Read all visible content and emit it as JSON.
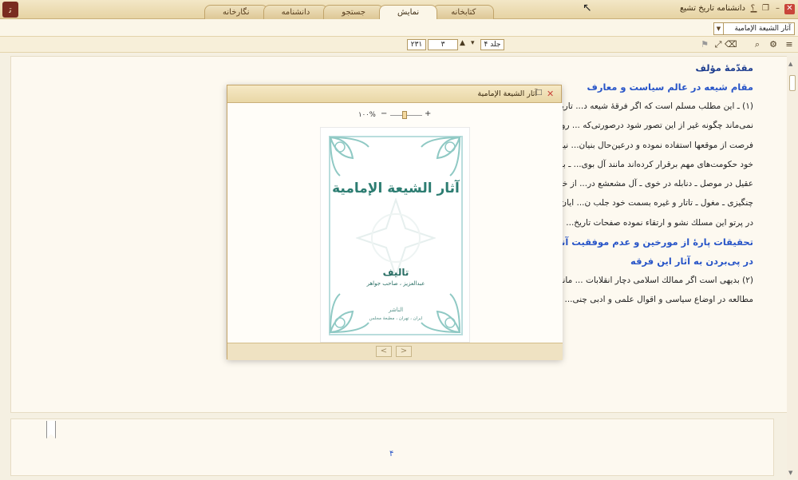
{
  "app": {
    "title": "دانشنامه تاریخ تشیع",
    "logo_glyph": "ﺗ",
    "help_glyph": "؟",
    "controls": [
      "▁",
      "❐",
      "–",
      "✕"
    ]
  },
  "tabs": [
    {
      "label": "کتابخانه",
      "active": false
    },
    {
      "label": "نمایش",
      "active": true
    },
    {
      "label": "جستجو",
      "active": false
    },
    {
      "label": "دانشنامه",
      "active": false
    },
    {
      "label": "نگارخانه",
      "active": false
    }
  ],
  "document_select": {
    "value": "آثار الشیعة الإمامیة",
    "arrow": "▼"
  },
  "toolbar": {
    "volume_label": "جلد ۴",
    "volume_dropdown": "▾",
    "page_value": "۳",
    "page_total": "۲۳۱",
    "nav_up": "▲",
    "nav_down": "▼",
    "icons": [
      "menu-icon",
      "settings-icon",
      "search-icon",
      "eraser-icon",
      "expand-icon",
      "bookmark-icon"
    ]
  },
  "page": {
    "heading_author_intro": "مقدّمهٔ مؤلف",
    "heading_shia_position": "مقام شیعه در عالم سیاست و معارف",
    "para1_lines": [
      "(۱) ـ این مطلب مسلم است که اگر فرقهٔ شیعه د... تاریخی با سایر فرق مقایسه شود از هیچ فرقه عقب",
      "نمی‌ماند چگونه غیر از این تصور شود درصورتی‌که ... روی مصلحت در پردهٔ تقیه به سر برده و با کمترین",
      "فرصت از موقعها استفاده نموده و درعین‌حال بنیان... نیروی هوش و ذکاء درهم شکسته در مدّت قلیلی از",
      "خود حکومت‌های مهم برقرار کرده‌اند مانند آل بوی... ـ بني دبیس در حلّه ـ بني شاهین در بطائح ـ بني",
      "عقیل در موصل ـ دنابله در خوی ـ آل مشعشع در... از خاندان عباسی ـ فاطمی ـ اخشیدی ـ سلجوقی ـ",
      "چنگیزی ـ مغول ـ تاتار و غیره بسمت خود جلب ن... ایان و رجال نامی سیاسی و روحاني و علمی و ادبی",
      "در پرتو این مسلك نشو و ارتقاء نموده صفحات تاریخ..."
    ],
    "heading_research": "تحقیقات پارهٔ از مورخین و عدم موفقیت آنان",
    "heading_traces": "در پی‌بردن به آثار این فرقه",
    "para2_lines": [
      "(۲) بدیهی است اگر ممالك اسلامی دچار انقلابات ... ماندہ عالم علم و ادب را مزین می‌نمود ـ بنابراین",
      "مطالعه در اوضاع سیاسی و اقوال علمی و ادبی چنی..."
    ],
    "page_number": "۴"
  },
  "modal": {
    "title": "آثار الشیعة الإمامیة",
    "close": "✕",
    "maximize": "□",
    "zoom_label": "۱۰۰%",
    "zoom_minus": "−",
    "zoom_plus": "+",
    "zoom_percent": 100,
    "prev": "<",
    "next": ">"
  },
  "cover": {
    "title": "آثار الشیعة الإمامیة",
    "tahlif": "تالیف",
    "author": "عبدالعزیز ، صاحب جواهر",
    "publisher": "الناشر",
    "place": "ایران ، تهران ، مطبعهٔ مجلس"
  },
  "colors": {
    "heading_blue": "#2855c8",
    "heading_dark_blue": "#1d3d8f",
    "cover_teal": "#2d7d72",
    "close_red": "#c9453a",
    "chrome_tan": "#e6d3a3"
  }
}
